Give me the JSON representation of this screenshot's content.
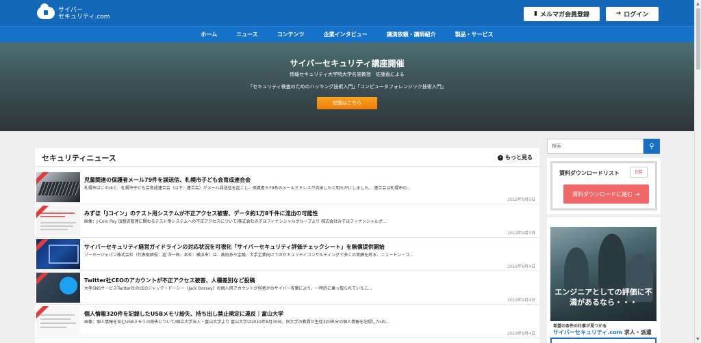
{
  "header": {
    "logo_line1": "サイバー",
    "logo_line2": "セキュリティ.com",
    "logo_mini": "Cyber Security",
    "mail_button": "メルマガ会員登録",
    "login_button": "ログイン"
  },
  "nav": {
    "items": [
      "ホーム",
      "ニュース",
      "コンテンツ",
      "企業インタビュー",
      "講演依頼・講師紹介",
      "製品・サービス"
    ]
  },
  "hero": {
    "title": "サイバーセキュリティ講座開催",
    "subtitle1": "情報セキュリティ大学院大学名誉教授　佐藤直による",
    "subtitle2": "「セキュリティ検査のためのハッキング技術入門」「コンピュータフォレンジック技術入門」",
    "button": "詳細はこちら"
  },
  "news": {
    "title": "セキュリティニュース",
    "more": "もっと見る",
    "items": [
      {
        "title": "児童関連の保護者メール79件を誤送信、札幌市子ども会育成連合会",
        "desc": "札幌市はこのほど、札幌市子ども会育成連合会（以下：連合会）がメール誤送信を起こし、保護者ら79名のメールアドレスが流出したと明らかにしました。 連合会は札幌市の...",
        "date": "2019年9月5日"
      },
      {
        "title": "みずほ「Jコイン」のテスト用システムが不正アクセス被害、データ約1万8千件に流出の可能性",
        "desc": "画像：J-Coin Pay 加盟店管理に関わるテスト用システムへの不正アクセスについて/株式会社みずほフィナンシャルグループより 株式会社みずほフィナンシャルグ...",
        "date": "2019年9月5日"
      },
      {
        "title": "サイバーセキュリティ経営ガイドラインの対応状況を可視化「サイバーセキュリティ評価チェックシート」を無償提供開始",
        "desc": "ゾーホージャパン株式会社（代表取締役：迫 洋一郎、本社：横浜市）は、政府系や金融、大手企業向けでのセキュリティコンサルティングで多くの実績を誇る、ニュートン・コ...",
        "date": "2019年9月4日"
      },
      {
        "title": "Twitter社CEOのアカウントが不正アクセス被害、人種差別など投稿",
        "desc": "大手SNSサービスTwitter社のCEOジャック・ドーシー（Jack Dorsey）の個人用アカウントが何者かのサイバー攻撃により、一時的に乗っ取られていたこ...",
        "date": "2019年9月4日"
      },
      {
        "title": "個人情報320件を記録したUSBメモリ紛失、持ち出し禁止規定に違反｜富山大学",
        "desc": "画像：個人情報を含むUSBメモリの紛失について/国立大学法人・富山大学より 富山大学は2019年8月30日、同大学の教員が生徒320名分の個人情報を記録したUS...",
        "date": "2019年9月4日"
      }
    ]
  },
  "sidebar": {
    "search_placeholder": "検索",
    "download_label": "資料ダウンロードリスト",
    "download_count": "0件",
    "download_button": "資料ダウンロードに進む",
    "ad_headline": "エンジニアとしての評価に不満があるなら・・・",
    "ad_small": "希望の条件の仕事が見つかる",
    "ad_brand": "サイバーセキュリティ.com",
    "ad_brand_suffix": " 求人・派遣"
  },
  "colors": {
    "header_blue": "#1468ba",
    "accent_orange": "#f39012",
    "cta_red": "#f26767"
  }
}
